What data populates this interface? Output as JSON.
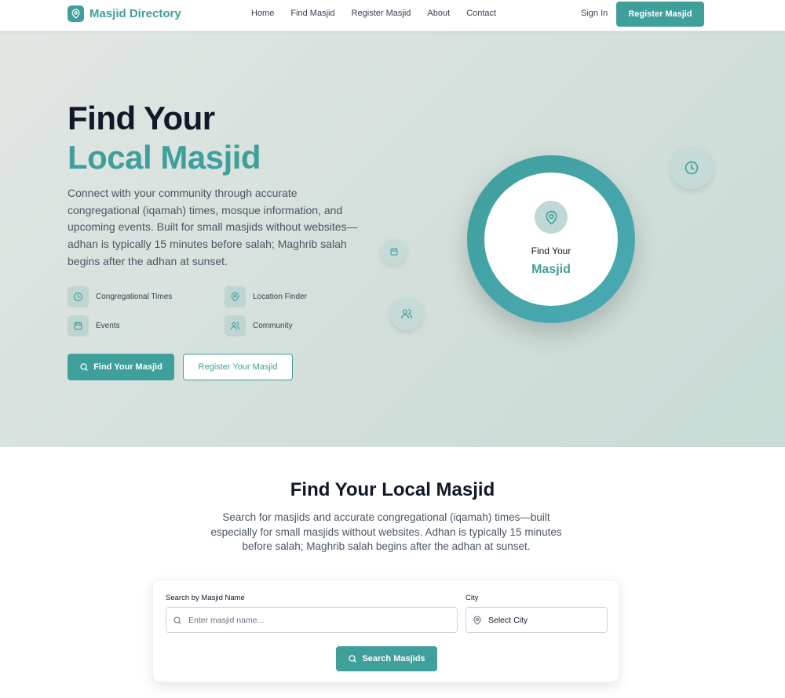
{
  "brand": {
    "name": "Masjid Directory",
    "icon": "map-pin-icon"
  },
  "nav": {
    "links": [
      "Home",
      "Find Masjid",
      "Register Masjid",
      "About",
      "Contact"
    ],
    "sign_in": "Sign In",
    "cta": "Register Masjid"
  },
  "hero": {
    "title_line1": "Find Your",
    "title_line2": "Local Masjid",
    "description": "Connect with your community through accurate congregational (iqamah) times, mosque information, and upcoming events. Built for small masjids without websites—adhan is typically 15 minutes before salah; Maghrib salah begins after the adhan at sunset.",
    "features": [
      {
        "label": "Congregational Times",
        "icon": "clock-icon"
      },
      {
        "label": "Location Finder",
        "icon": "map-pin-icon"
      },
      {
        "label": "Events",
        "icon": "calendar-icon"
      },
      {
        "label": "Community",
        "icon": "users-icon"
      }
    ],
    "primary_button": "Find Your Masjid",
    "secondary_button": "Register Your Masjid",
    "circle": {
      "line1": "Find Your",
      "line2": "Masjid"
    }
  },
  "search_section": {
    "title": "Find Your Local Masjid",
    "description": "Search for masjids and accurate congregational (iqamah) times—built especially for small masjids without websites. Adhan is typically 15 minutes before salah; Maghrib salah begins after the adhan at sunset.",
    "name_label": "Search by Masjid Name",
    "name_placeholder": "Enter masjid name...",
    "city_label": "City",
    "city_value": "Select City",
    "button": "Search Masjids"
  },
  "colors": {
    "accent": "#3f9f9b",
    "text": "#111827",
    "muted": "#4b5563"
  }
}
